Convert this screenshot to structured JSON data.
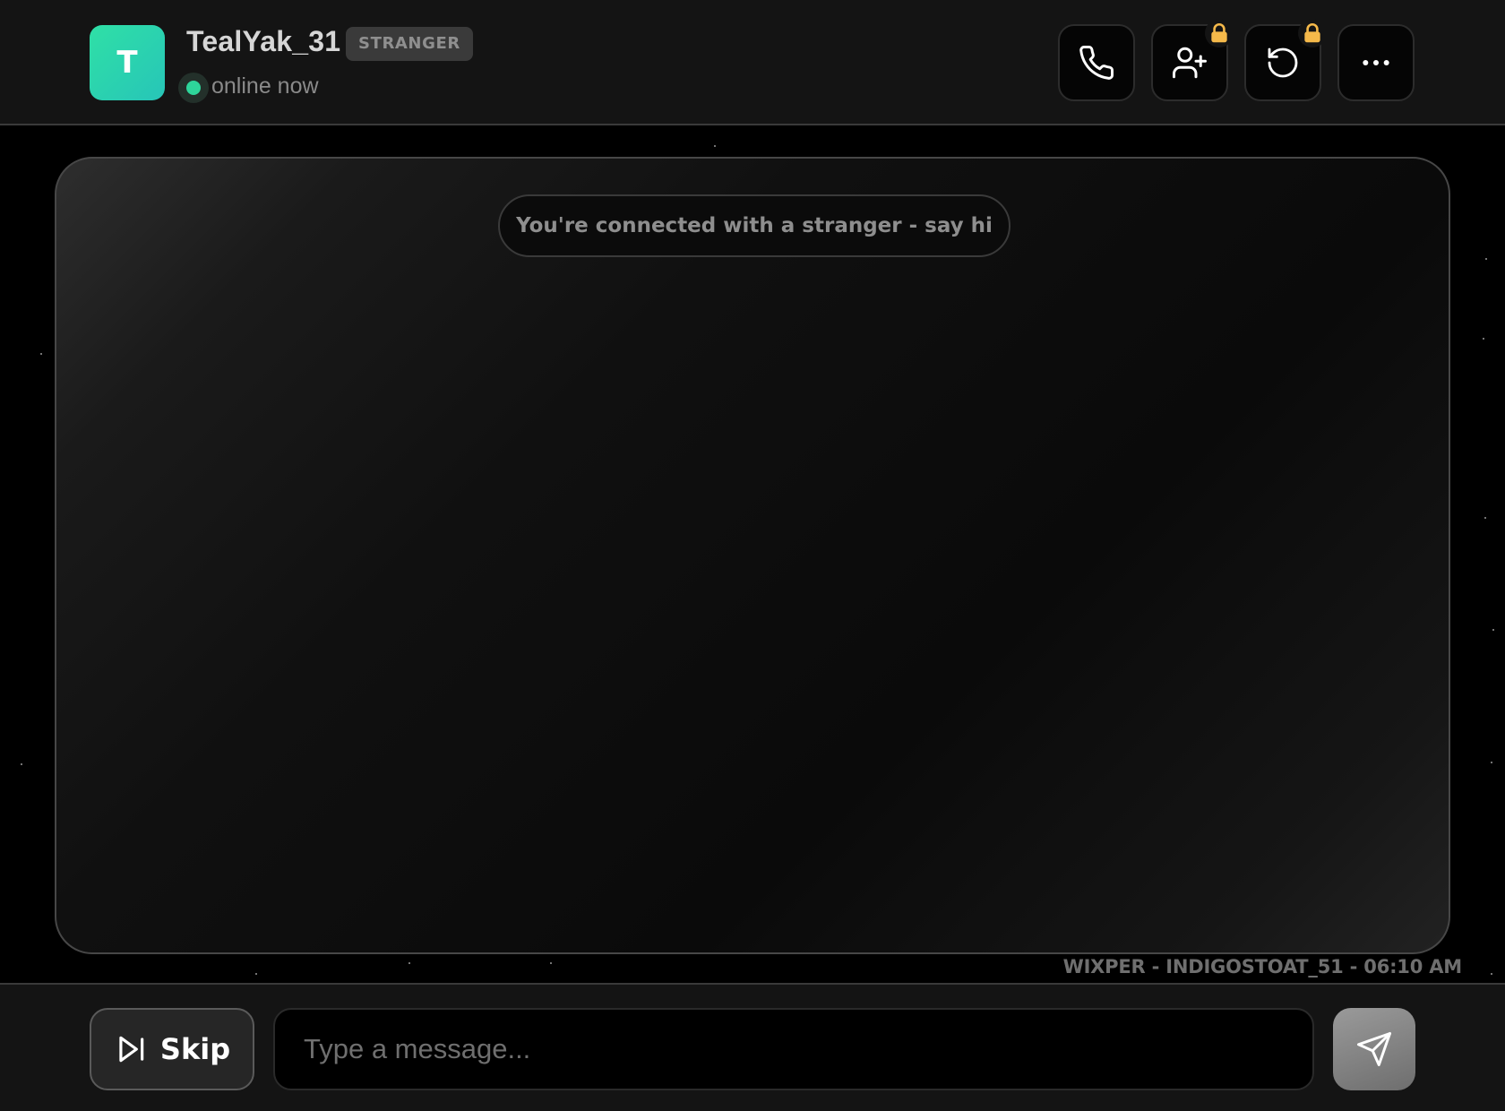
{
  "header": {
    "avatar_letter": "T",
    "username": "TealYak_31",
    "badge": "STRANGER",
    "status": "online now",
    "status_color": "#2ed59a",
    "avatar_gradient": [
      "#2fe0a6",
      "#27c5b8"
    ],
    "actions": [
      {
        "icon": "phone-icon",
        "locked": false
      },
      {
        "icon": "add-user-icon",
        "locked": true
      },
      {
        "icon": "refresh-icon",
        "locked": true
      },
      {
        "icon": "more-options-icon",
        "locked": false
      }
    ],
    "lock_color": "#f5b94a"
  },
  "chat": {
    "notice": "You're connected with a stranger - say hi",
    "watermark": "WIXPER - INDIGOSTOAT_51 - 06:10 AM"
  },
  "composer": {
    "skip_label": "Skip",
    "placeholder": "Type a message...",
    "value": ""
  }
}
